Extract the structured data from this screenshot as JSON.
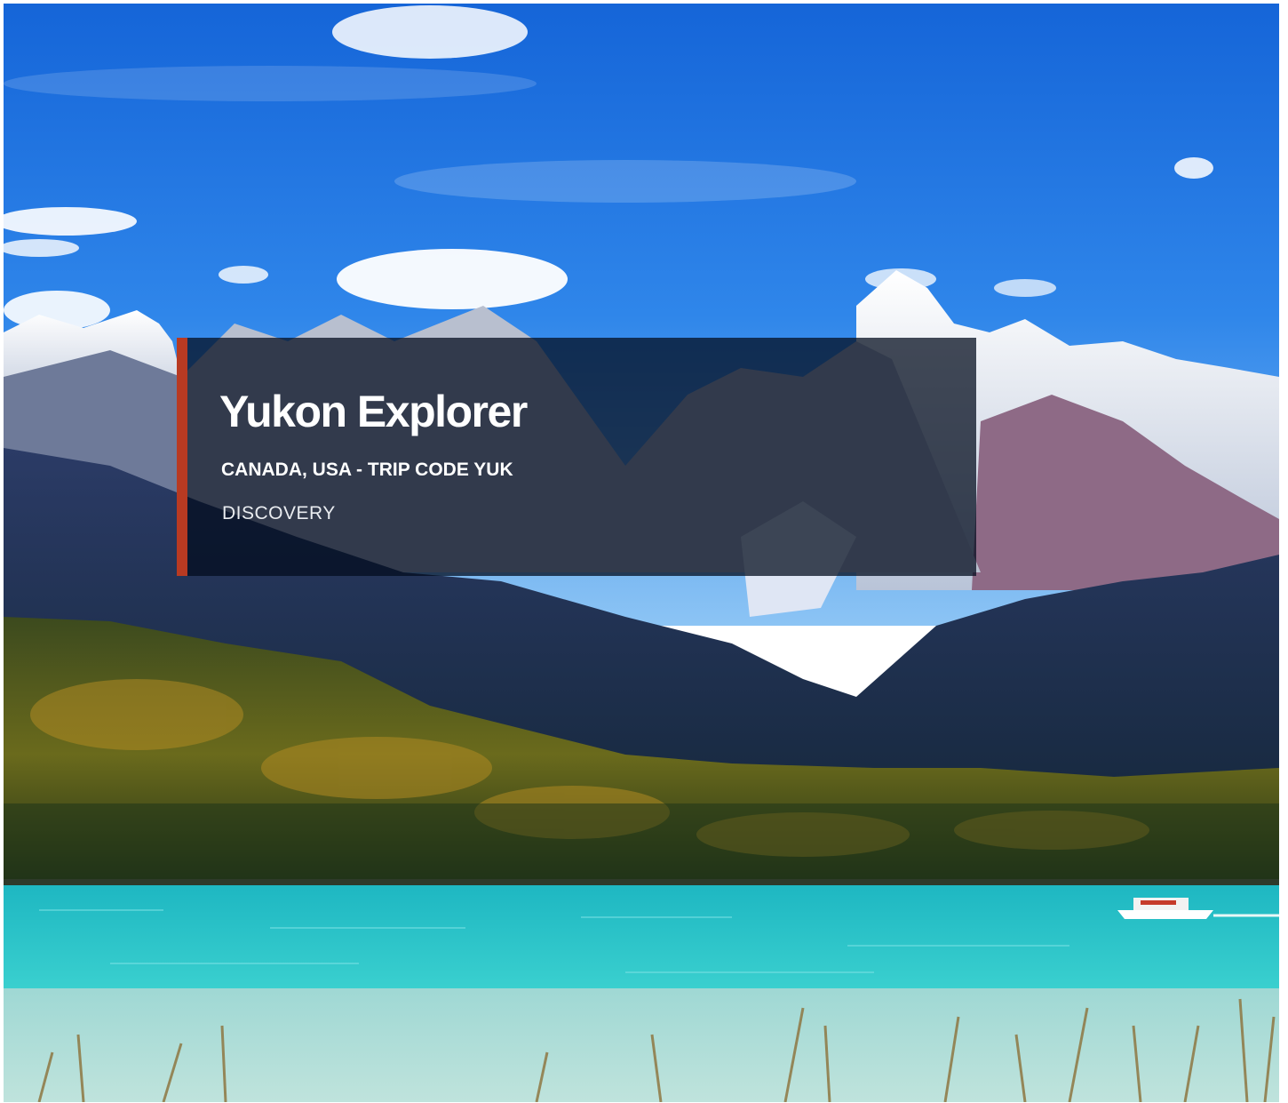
{
  "hero": {
    "image_subject": "mountain-lake-landscape",
    "trip": {
      "title": "Yukon Explorer",
      "subtitle": "CANADA, USA - TRIP CODE YUK",
      "category": "DISCOVERY"
    }
  },
  "colors": {
    "accent": "#b83a22",
    "overlay": "#030c1e",
    "sky": "#1f6fe0",
    "water": "#2cc2c8"
  }
}
